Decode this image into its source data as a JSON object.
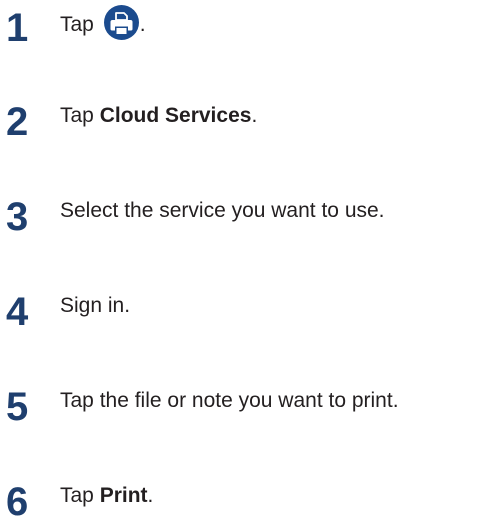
{
  "steps": [
    {
      "number": "1",
      "text_before": "Tap ",
      "text_after": ".",
      "icon": "print-icon"
    },
    {
      "number": "2",
      "text_before": "Tap ",
      "bold": "Cloud Services",
      "text_after": "."
    },
    {
      "number": "3",
      "text": "Select the service you want to use."
    },
    {
      "number": "4",
      "text": "Sign in."
    },
    {
      "number": "5",
      "text": "Tap the file or note you want to print."
    },
    {
      "number": "6",
      "text_before": "Tap ",
      "bold": "Print",
      "text_after": "."
    }
  ],
  "colors": {
    "step_number": "#1f3f6e",
    "icon_background": "#1b4b8e",
    "text": "#231f20"
  }
}
